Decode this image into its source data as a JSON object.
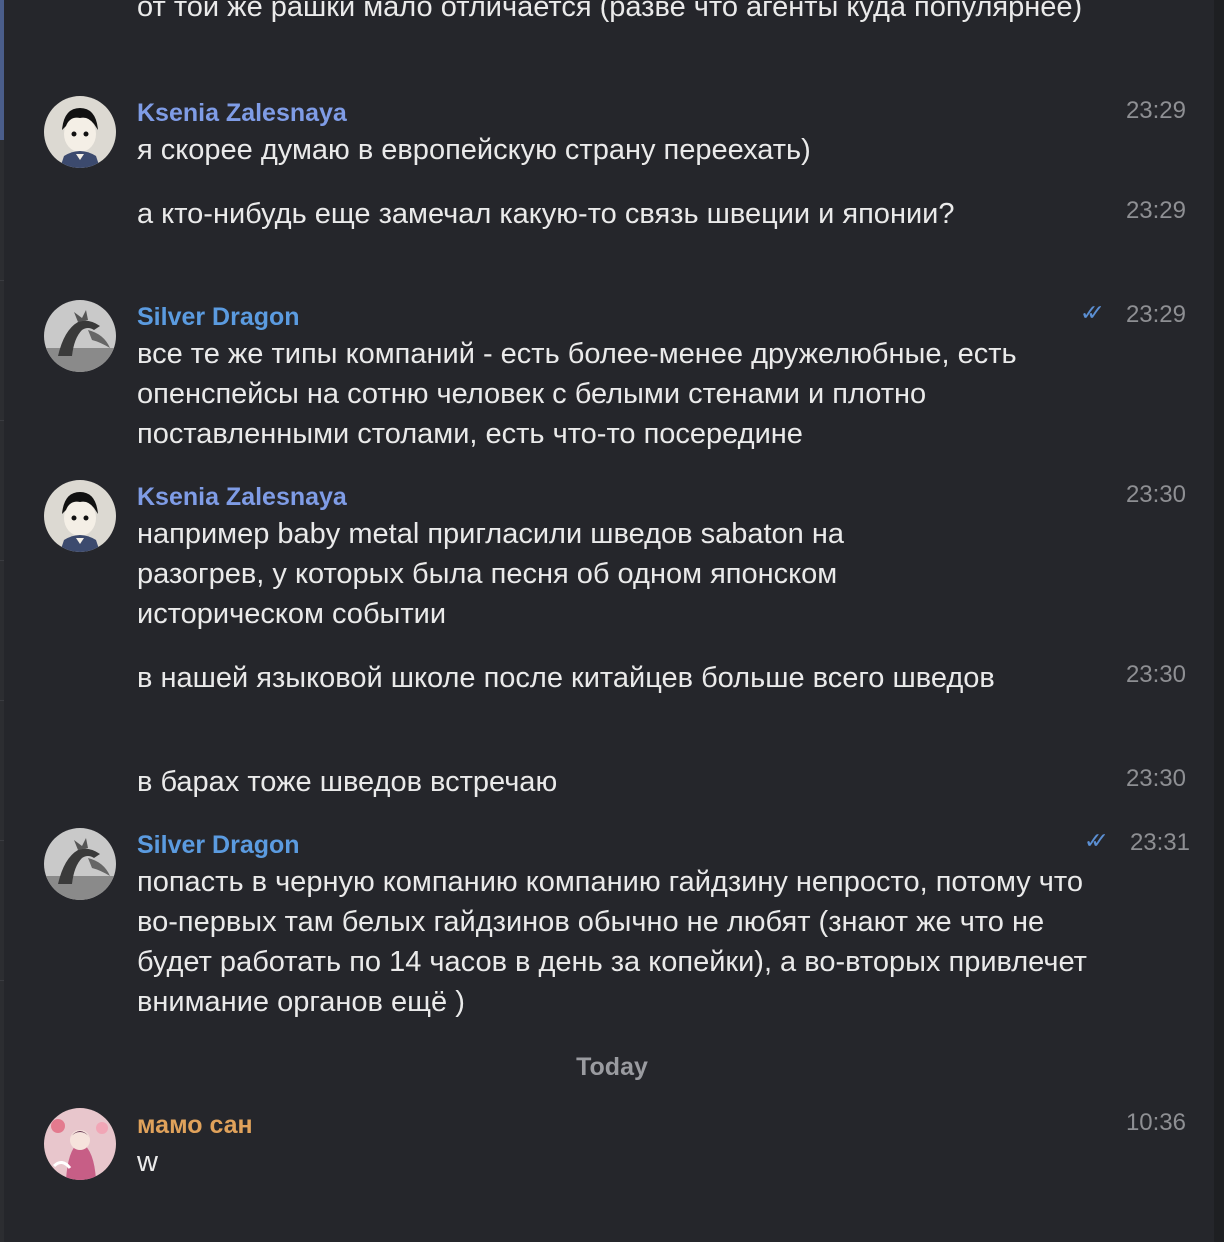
{
  "messages": [
    {
      "text": "от той же рашки мало отличается (разве что агенты куда популярнее)"
    },
    {
      "sender": "Ksenia Zalesnaya",
      "time": "23:29",
      "text": "я скорее думаю в европейскую страну переехать)"
    },
    {
      "time": "23:29",
      "text": "а кто-нибудь еще замечал какую-то связь швеции и японии?"
    },
    {
      "sender": "Silver Dragon",
      "time": "23:29",
      "status": "read",
      "text": "все те же типы компаний - есть более-менее дружелюбные, есть опенспейсы на сотню человек с белыми стенами и плотно поставленными столами, есть что-то посередине"
    },
    {
      "sender": "Ksenia Zalesnaya",
      "time": "23:30",
      "text": "например baby metal пригласили шведов sabaton на разогрев, у которых была песня об одном японском историческом событии"
    },
    {
      "time": "23:30",
      "text": "в нашей языковой школе после китайцев больше всего шведов"
    },
    {
      "time": "23:30",
      "text": "в барах тоже шведов встречаю"
    },
    {
      "sender": "Silver Dragon",
      "time": "23:31",
      "status": "read",
      "text": "попасть в черную компанию компанию гайдзину непросто, потому что во-первых там белых гайдзинов обычно не любят (знают же что не будет работать по 14 часов в день за копейки), а во-вторых привлечет внимание органов ещё )"
    },
    {
      "sender": "мамо сан",
      "time": "10:36",
      "text": "w"
    }
  ],
  "date_separator": "Today",
  "colors": {
    "background": "#25262b",
    "ksenia_name": "#7f9ce6",
    "silver_name": "#5b9be0",
    "mamo_name": "#e0a25b",
    "read_check": "#5b8fd3"
  },
  "icons": {
    "read_status": "double-check-icon"
  }
}
